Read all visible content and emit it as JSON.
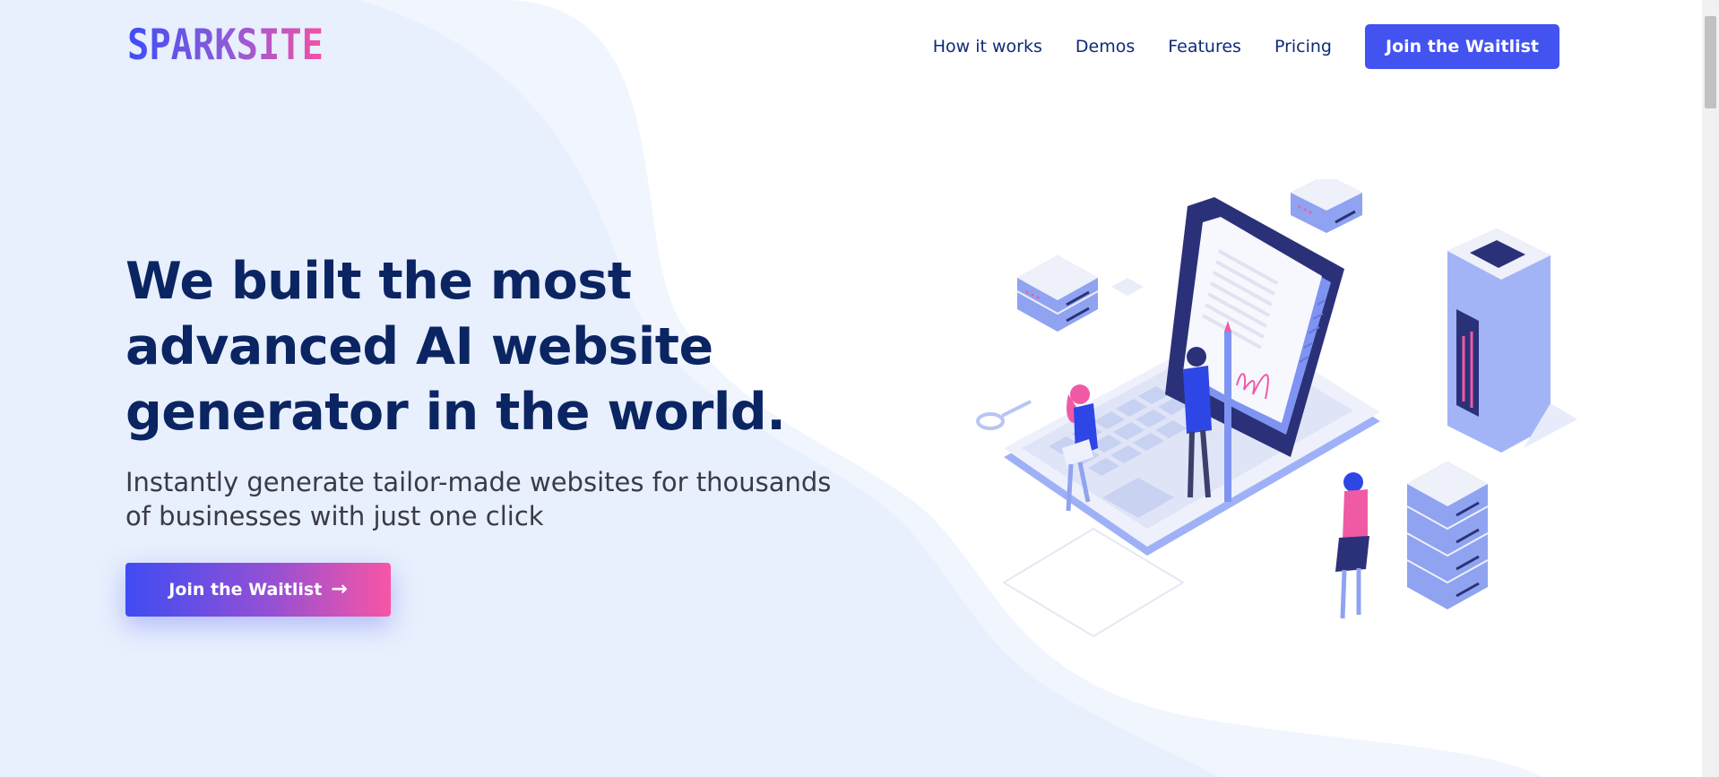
{
  "brand": {
    "logo_text": "SPARKSITE"
  },
  "nav": {
    "links": [
      "How it works",
      "Demos",
      "Features",
      "Pricing"
    ],
    "cta_label": "Join the Waitlist"
  },
  "hero": {
    "title": "We built the most advanced AI website generator in the world.",
    "subtitle": "Instantly generate tailor-made websites for thousands of businesses with just one click",
    "cta_label": "Join the Waitlist",
    "cta_icon": "arrow-right-icon"
  },
  "colors": {
    "navy": "#0b2563",
    "accent_blue": "#4353f0",
    "gradient_pink": "#f755a5",
    "background_tint": "#e8effd"
  }
}
